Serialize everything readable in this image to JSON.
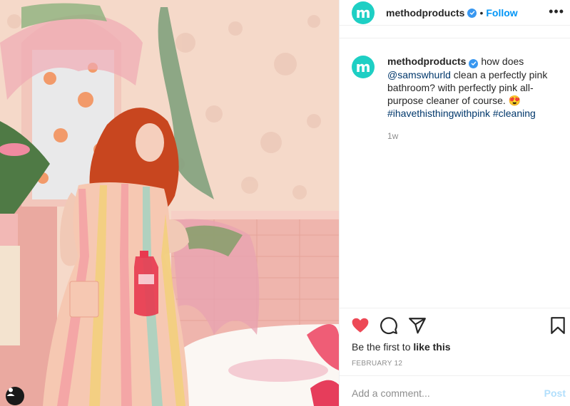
{
  "post": {
    "username": "methodproducts",
    "avatar_letter": "m",
    "follow_label": "Follow",
    "separator": "•",
    "more_label": "•••",
    "caption": {
      "username": "methodproducts",
      "text_1": " how does ",
      "mention": "@samswhurld",
      "text_2": " clean a perfectly pink bathroom? with perfectly pink all-purpose cleaner of course. 😍 ",
      "hashtag_1": "#ihavethisthingwithpink",
      "hashtag_2": "#cleaning"
    },
    "time_ago": "1w",
    "likes_prefix": "Be the first to ",
    "likes_link": "like this",
    "date": "FEBRUARY 12",
    "comment_placeholder": "Add a comment...",
    "post_label": "Post"
  },
  "colors": {
    "brand_teal": "#1ecfc4",
    "like_red": "#ed4956",
    "link_blue": "#0095f6",
    "verified_blue": "#3897f0"
  },
  "icons": {
    "like": "heart-icon",
    "comment": "comment-icon",
    "share": "paper-plane-icon",
    "save": "bookmark-icon",
    "verified": "verified-badge-icon",
    "profile": "user-icon"
  }
}
